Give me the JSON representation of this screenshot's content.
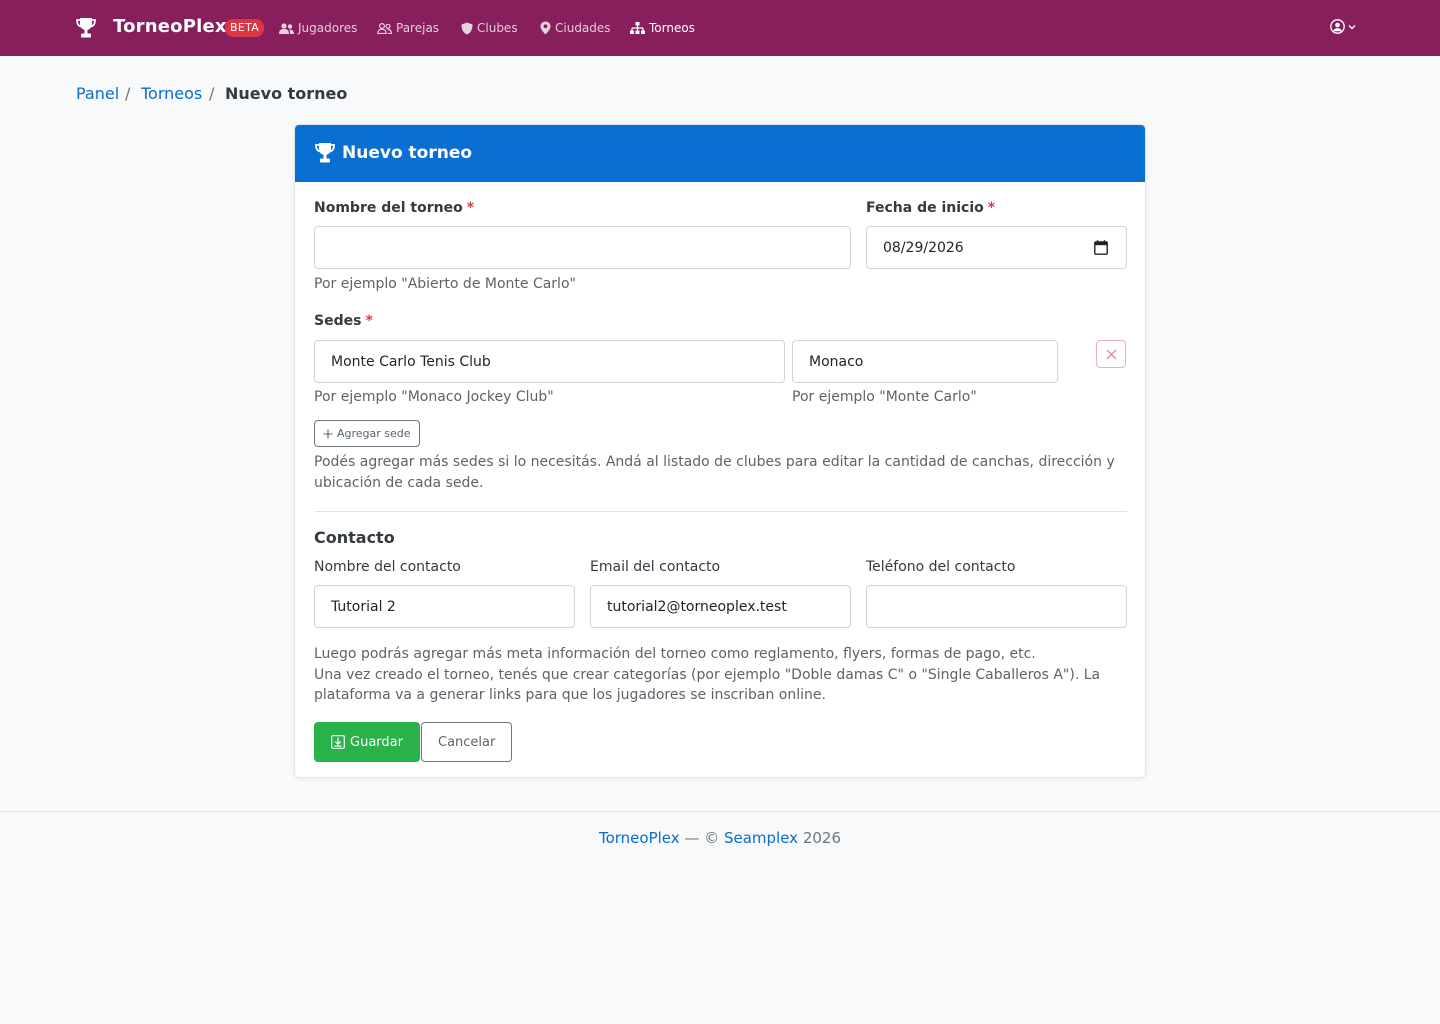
{
  "navbar": {
    "brand": "TorneoPlex",
    "badge": "BETA",
    "items": [
      {
        "label": "Jugadores",
        "icon": "users-icon"
      },
      {
        "label": "Parejas",
        "icon": "user-pair-icon"
      },
      {
        "label": "Clubes",
        "icon": "shield-icon"
      },
      {
        "label": "Ciudades",
        "icon": "map-marker-icon"
      },
      {
        "label": "Torneos",
        "icon": "sitemap-icon",
        "active": true
      }
    ],
    "user_menu_icon": "user-circle-icon"
  },
  "breadcrumb": {
    "items": [
      "Panel",
      "Torneos"
    ],
    "separator": "/",
    "current": "Nuevo torneo"
  },
  "form": {
    "title": "Nuevo torneo",
    "required_mark": "*",
    "name": {
      "label": "Nombre del torneo",
      "value": "",
      "help": "Por ejemplo \"Abierto de Monte Carlo\""
    },
    "start_date": {
      "label": "Fecha de inicio",
      "value": "08/29/2026"
    },
    "venues": {
      "label": "Sedes",
      "rows": [
        {
          "club": "Monte Carlo Tenis Club",
          "city": "Monaco",
          "club_help": "Por ejemplo \"Monaco Jockey Club\"",
          "city_help": "Por ejemplo \"Monte Carlo\""
        }
      ],
      "add_label": "Agregar sede",
      "note": "Podés agregar más sedes si lo necesitás. Andá al listado de clubes para editar la cantidad de canchas, dirección y ubicación de cada sede."
    },
    "contact": {
      "title": "Contacto",
      "name_label": "Nombre del contacto",
      "name_value": "Tutorial 2",
      "email_label": "Email del contacto",
      "email_value": "tutorial2@torneoplex.test",
      "phone_label": "Teléfono del contacto",
      "phone_value": ""
    },
    "info_line1": "Luego podrás agregar más meta información del torneo como reglamento, flyers, formas de pago, etc.",
    "info_line2": "Una vez creado el torneo, tenés que crear categorías (por ejemplo \"Doble damas C\" o \"Single Caballeros A\"). La plataforma va a generar links para que los jugadores se inscriban online.",
    "save_label": "Guardar",
    "cancel_label": "Cancelar"
  },
  "footer": {
    "brand": "TorneoPlex",
    "sep": " — © ",
    "company": "Seamplex",
    "year": " 2026"
  },
  "colors": {
    "navbar": "#871f5d",
    "card_header": "#0a6fd3",
    "link": "#0a6ccb",
    "save": "#29b14a",
    "danger": "#dc3545"
  }
}
